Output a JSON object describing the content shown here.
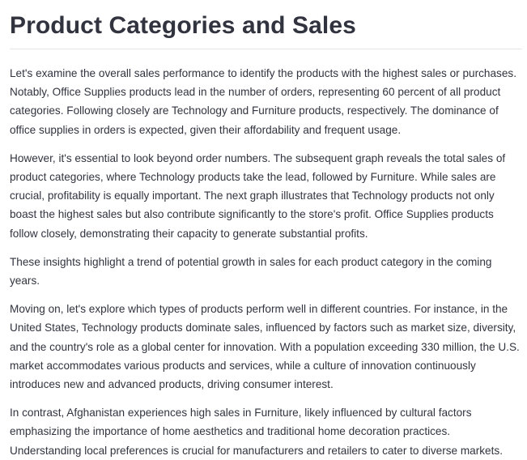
{
  "title": "Product Categories and Sales",
  "paragraphs": [
    "Let's examine the overall sales performance to identify the products with the highest sales or purchases. Notably, Office Supplies products lead in the number of orders, representing 60 percent of all product categories. Following closely are Technology and Furniture products, respectively. The dominance of office supplies in orders is expected, given their affordability and frequent usage.",
    "However, it's essential to look beyond order numbers. The subsequent graph reveals the total sales of product categories, where Technology products take the lead, followed by Furniture. While sales are crucial, profitability is equally important. The next graph illustrates that Technology products not only boast the highest sales but also contribute significantly to the store's profit. Office Supplies products follow closely, demonstrating their capacity to generate substantial profits.",
    "These insights highlight a trend of potential growth in sales for each product category in the coming years.",
    "Moving on, let's explore which types of products perform well in different countries. For instance, in the United States, Technology products dominate sales, influenced by factors such as market size, diversity, and the country's role as a global center for innovation. With a population exceeding 330 million, the U.S. market accommodates various products and services, while a culture of innovation continuously introduces new and advanced products, driving consumer interest.",
    "In contrast, Afghanistan experiences high sales in Furniture, likely influenced by cultural factors emphasizing the importance of home aesthetics and traditional home decoration practices. Understanding local preferences is crucial for manufacturers and retailers to cater to diverse markets."
  ]
}
